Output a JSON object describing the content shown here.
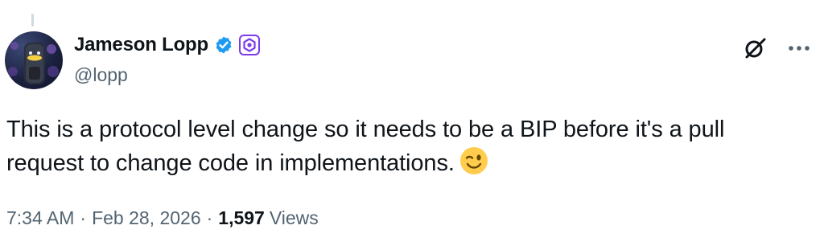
{
  "author": {
    "display_name": "Jameson Lopp",
    "handle": "@lopp",
    "verified_badge_icon": "verified-check-icon",
    "affiliate_badge_icon": "affiliate-badge-icon",
    "verified_color": "#1d9bf0",
    "affiliate_color": "#7c3aed"
  },
  "actions": {
    "grok_icon": "grok-icon",
    "more_icon": "more-options-icon"
  },
  "tweet": {
    "text": "This is a protocol level change so it needs to be a BIP before it's a pull request to change code in implementations.",
    "emoji": "winking-face-emoji"
  },
  "meta": {
    "time": "7:34 AM",
    "separator": "·",
    "date": "Feb 28, 2026",
    "views_count": "1,597",
    "views_label": "Views"
  }
}
